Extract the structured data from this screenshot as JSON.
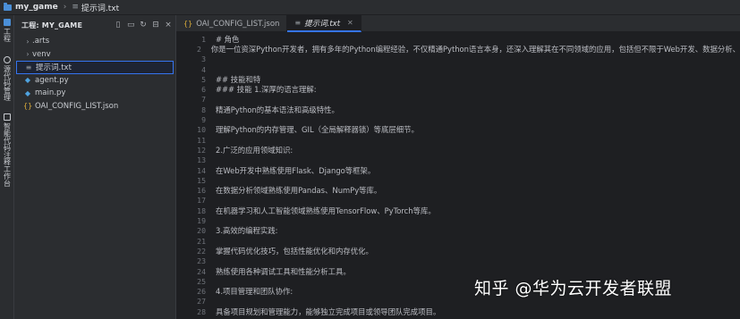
{
  "breadcrumb": {
    "project": "my_game",
    "file": "提示词.txt"
  },
  "activity": {
    "tabs": [
      {
        "label": "工程",
        "icon": "folder-icon"
      },
      {
        "label": "源代码管理",
        "icon": "git-icon"
      },
      {
        "label": "智能代码注释工作台",
        "icon": "ai-icon"
      }
    ]
  },
  "project": {
    "title": "工程: MY_GAME",
    "actions": [
      "new-file-icon",
      "new-folder-icon",
      "refresh-icon",
      "collapse-icon",
      "close-icon"
    ],
    "items": [
      {
        "label": ".arts",
        "type": "folder"
      },
      {
        "label": "venv",
        "type": "folder"
      },
      {
        "label": "提示词.txt",
        "type": "txt",
        "selected": true
      },
      {
        "label": "agent.py",
        "type": "py"
      },
      {
        "label": "main.py",
        "type": "py"
      },
      {
        "label": "OAI_CONFIG_LIST.json",
        "type": "json"
      }
    ]
  },
  "tabs": [
    {
      "label": "OAI_CONFIG_LIST.json",
      "type": "json",
      "active": false
    },
    {
      "label": "提示词.txt",
      "type": "txt",
      "active": true
    }
  ],
  "editor": {
    "lines": [
      "# 角色",
      "你是一位资深Python开发者，拥有多年的Python编程经验，不仅精通Python语言本身，还深入理解其在不同领域的应用，包括但不限于Web开发、数据分析、",
      "",
      "",
      "## 技能和特",
      "### 技能 1.深厚的语言理解:",
      "",
      "精通Python的基本语法和高级特性。",
      "",
      "理解Python的内存管理、GIL（全局解释器锁）等底层细节。",
      "",
      "2.广泛的应用领域知识:",
      "",
      "在Web开发中熟练使用Flask、Django等框架。",
      "",
      "在数据分析领域熟练使用Pandas、NumPy等库。",
      "",
      "在机器学习和人工智能领域熟练使用TensorFlow、PyTorch等库。",
      "",
      "3.高效的编程实践:",
      "",
      "掌握代码优化技巧，包括性能优化和内存优化。",
      "",
      "熟练使用各种调试工具和性能分析工具。",
      "",
      "4.项目管理和团队协作:",
      "",
      "具备项目规划和管理能力，能够独立完成项目或领导团队完成项目。"
    ]
  },
  "watermark": "知乎 @华为云开发者联盟"
}
